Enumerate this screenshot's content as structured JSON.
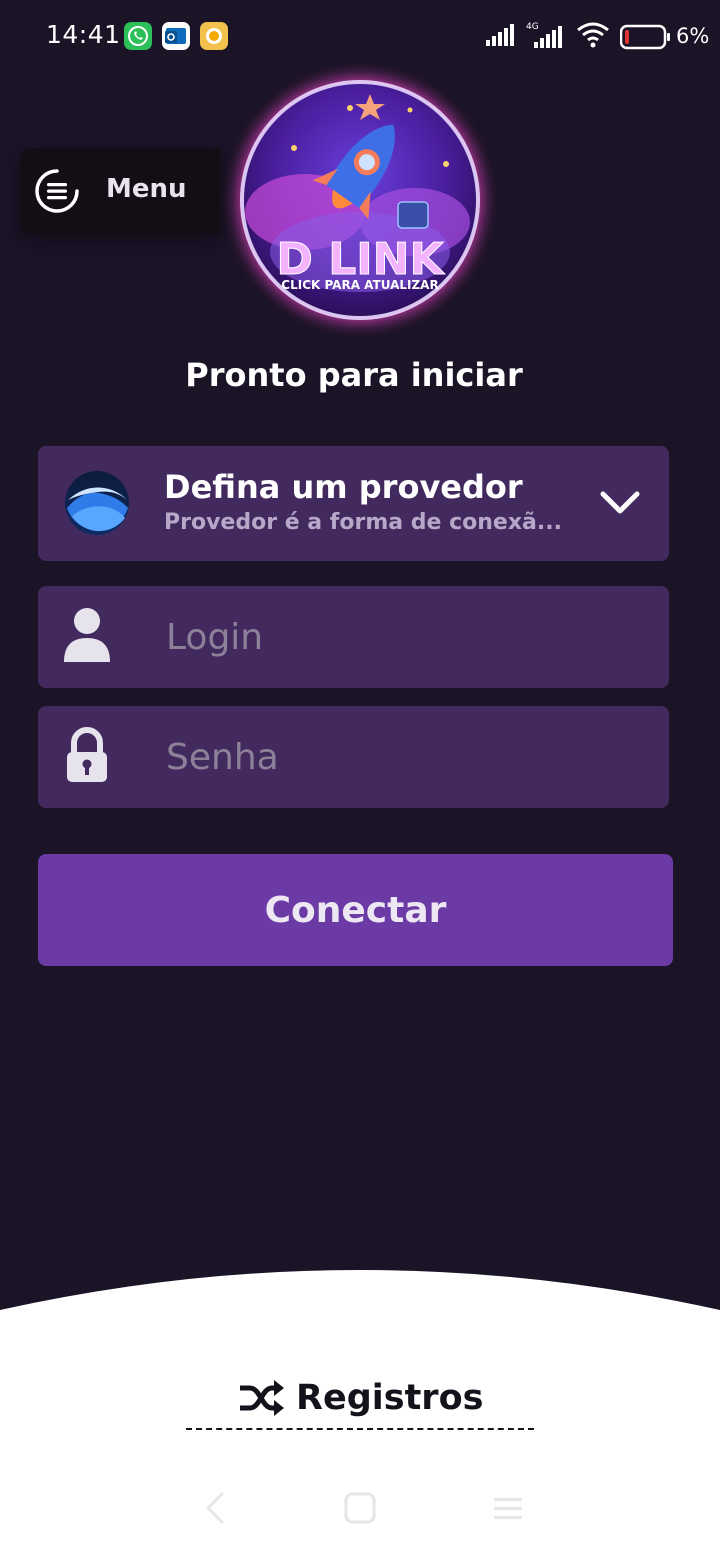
{
  "status_bar": {
    "time": "14:41",
    "battery": "6%",
    "network": "4G",
    "icons": [
      "whatsapp-icon",
      "outlook-icon",
      "app-notification-icon",
      "signal-icon",
      "signal-4g-icon",
      "wifi-icon",
      "battery-icon"
    ]
  },
  "logo": {
    "brand": "D LINK",
    "tagline": "CLICK PARA ATUALIZAR"
  },
  "menu": {
    "label": "Menu",
    "icon": "hamburger-menu-icon"
  },
  "headline": "Pronto para iniciar",
  "provider": {
    "title": "Defina um provedor",
    "subtitle": "Provedor é a forma de conexã...",
    "icon": "provider-globe-icon",
    "chevron": "chevron-down-icon"
  },
  "form": {
    "login_placeholder": "Login",
    "password_placeholder": "Senha",
    "login_icon": "user-icon",
    "password_icon": "lock-icon"
  },
  "connect_button": {
    "label": "Conectar"
  },
  "footer": {
    "registros_label": "Registros",
    "registros_icon": "shuffle-icon"
  },
  "nav": {
    "icons": [
      "back-icon",
      "home-icon",
      "recents-icon"
    ]
  },
  "colors": {
    "background": "#1b1326",
    "card": "#432a5e",
    "button": "#6b3aa5",
    "text_primary": "#ffffff",
    "text_muted": "#b7a7c9"
  }
}
